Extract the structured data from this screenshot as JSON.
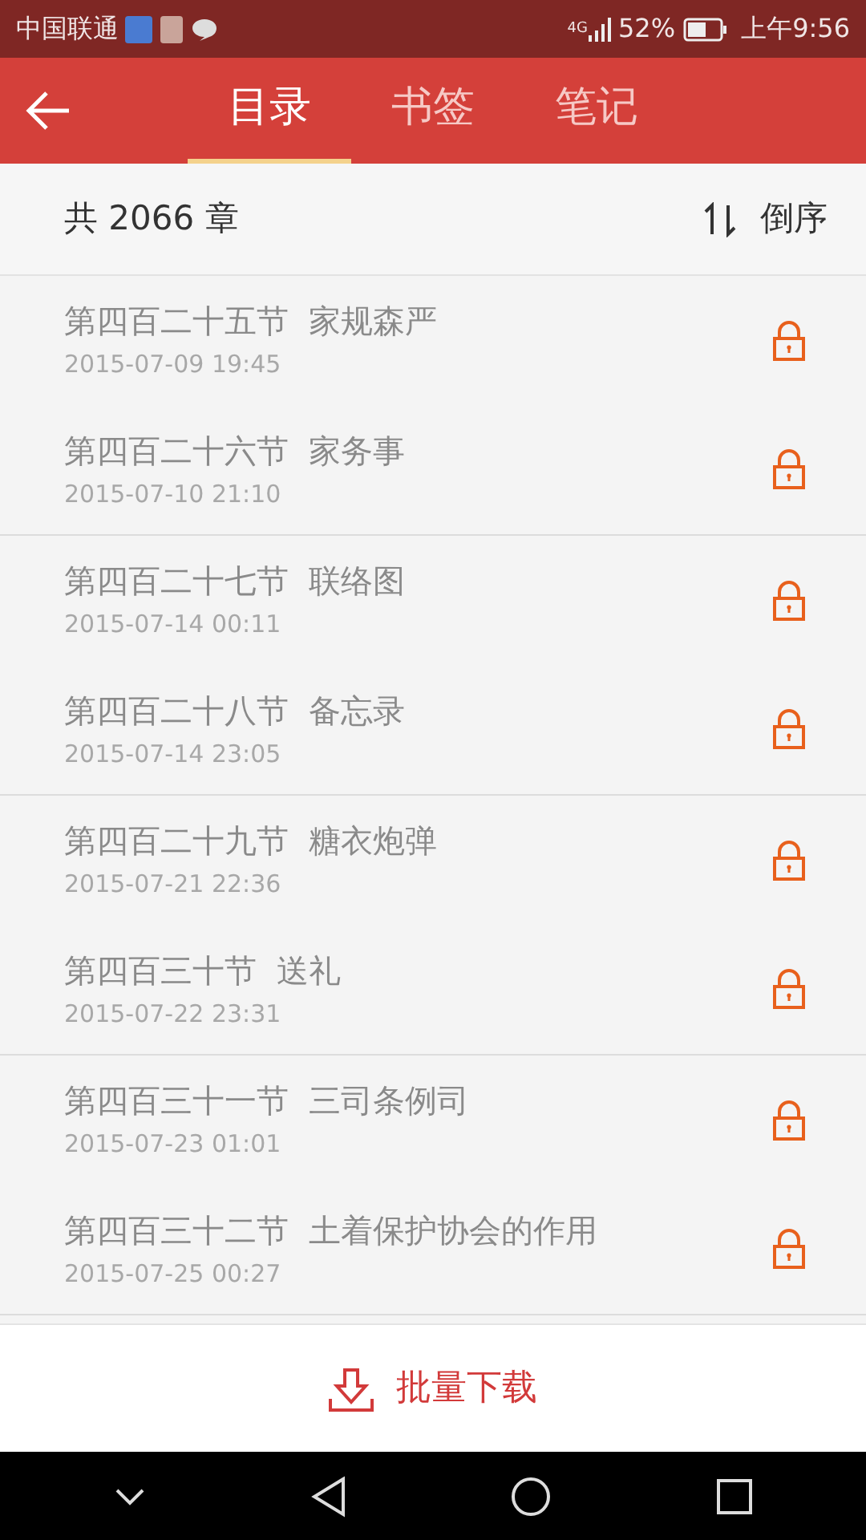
{
  "status_bar": {
    "carrier": "中国联通",
    "network": "4G",
    "battery": "52%",
    "time": "上午9:56"
  },
  "tabs": [
    {
      "label": "目录",
      "selected": true
    },
    {
      "label": "书签",
      "selected": false
    },
    {
      "label": "笔记",
      "selected": false
    }
  ],
  "summary": {
    "count": "共 2066 章",
    "sort": "倒序"
  },
  "chapters": [
    {
      "title": "第四百二十五节  家规森严",
      "date": "2015-07-09 19:45",
      "locked": true
    },
    {
      "title": "第四百二十六节  家务事",
      "date": "2015-07-10 21:10",
      "locked": true
    },
    {
      "title": "第四百二十七节  联络图",
      "date": "2015-07-14 00:11",
      "locked": true
    },
    {
      "title": "第四百二十八节  备忘录",
      "date": "2015-07-14 23:05",
      "locked": true
    },
    {
      "title": "第四百二十九节  糖衣炮弹",
      "date": "2015-07-21 22:36",
      "locked": true
    },
    {
      "title": "第四百三十节  送礼",
      "date": "2015-07-22 23:31",
      "locked": true
    },
    {
      "title": "第四百三十一节  三司条例司",
      "date": "2015-07-23 01:01",
      "locked": true
    },
    {
      "title": "第四百三十二节  土着保护协会的作用",
      "date": "2015-07-25 00:27",
      "locked": true
    }
  ],
  "download_button": "批量下载"
}
